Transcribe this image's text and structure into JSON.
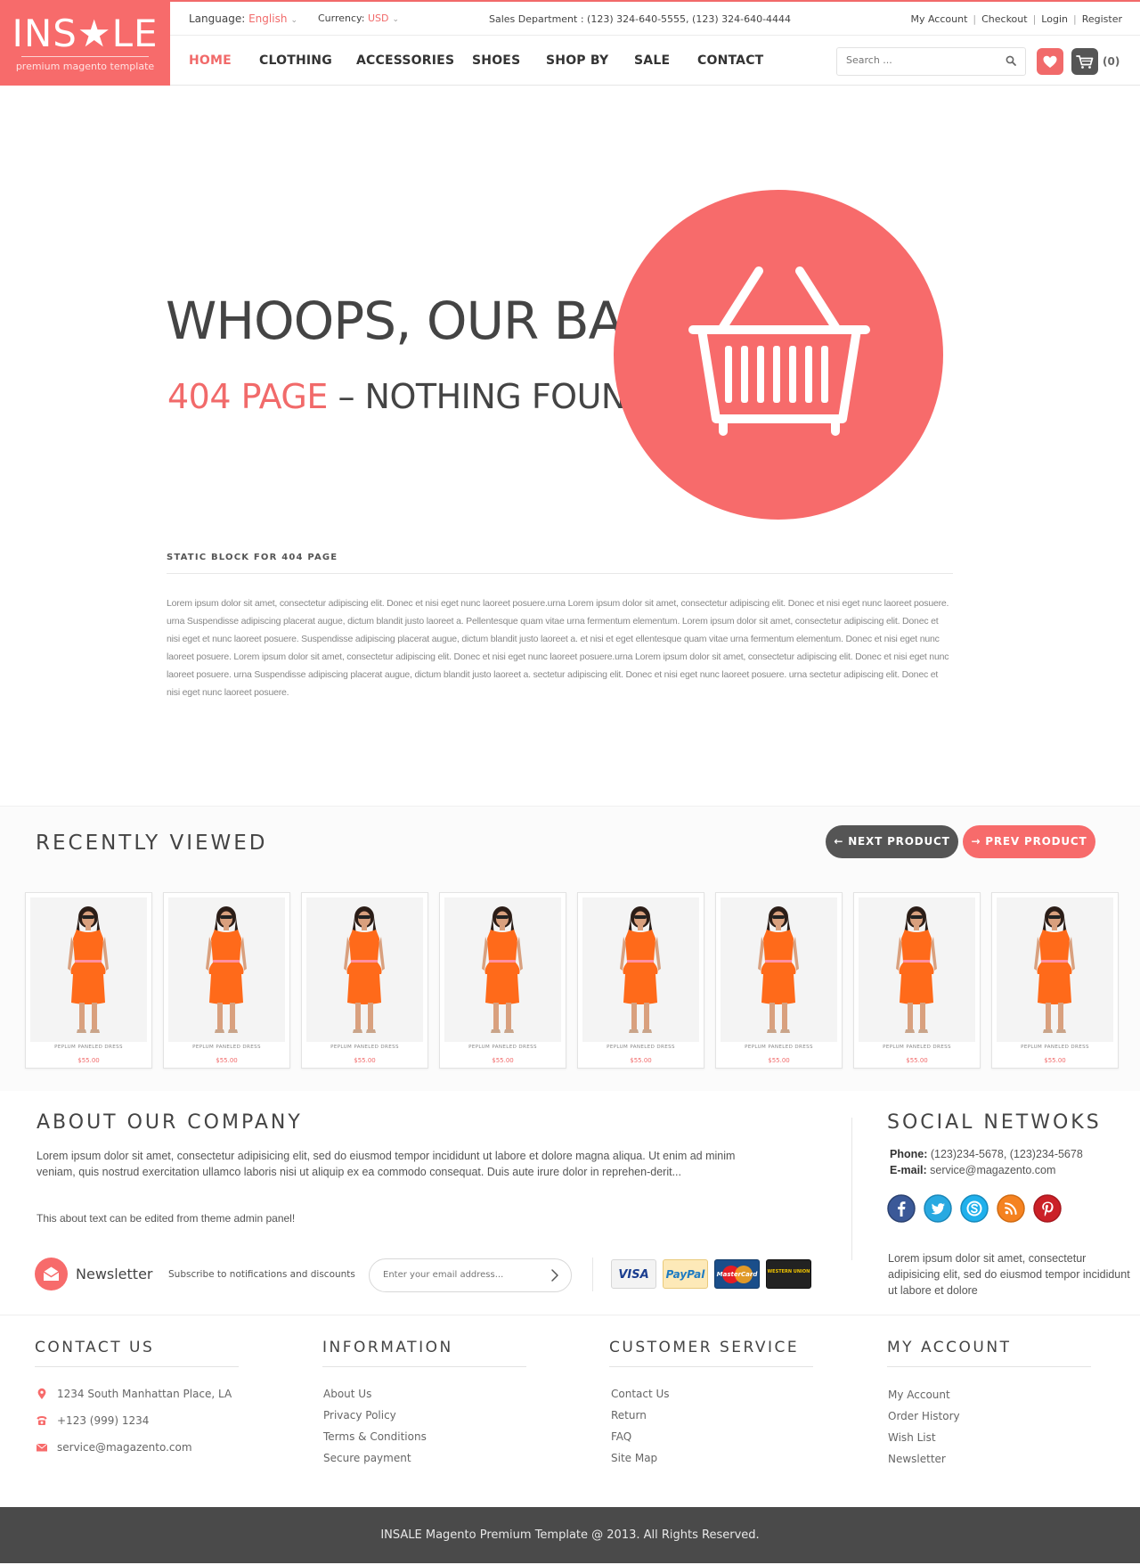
{
  "logo": {
    "word": "INS★LE",
    "tagline": "premium magento template",
    "color": "#f76b6b"
  },
  "topbar": {
    "language_label": "Language:",
    "language_value": "English",
    "currency_label": "Currency:",
    "currency_value": "USD",
    "sales": "Sales Department : (123) 324-640-5555, (123) 324-640-4444",
    "links": [
      "My Account",
      "Checkout",
      "Login",
      "Register"
    ]
  },
  "nav": {
    "items": [
      "HOME",
      "CLOTHING",
      "ACCESSORIES",
      "SHOES",
      "SHOP BY",
      "SALE",
      "CONTACT"
    ],
    "active": "HOME"
  },
  "search": {
    "placeholder": "Search ..."
  },
  "cart": {
    "count": "(0)"
  },
  "hero": {
    "title": "WHOOPS, OUR BAD",
    "sub_red": "404 PAGE",
    "sub_rest": " – NOTHING FOUND"
  },
  "static_block": {
    "title": "STATIC BLOCK FOR 404 PAGE",
    "text": "Lorem ipsum dolor sit amet, consectetur adipiscing elit. Donec et nisi eget nunc laoreet posuere.urna  Lorem ipsum dolor sit amet, consectetur adipiscing elit. Donec et nisi eget nunc laoreet posuere. urna Suspendisse adipiscing placerat augue, dictum blandit justo laoreet a. Pellentesque quam vitae urna fermentum elementum. Lorem ipsum dolor sit amet, consectetur adipiscing elit. Donec et nisi eget et nunc laoreet posuere. Suspendisse adipiscing placerat augue, dictum blandit justo laoreet a. et nisi et eget ellentesque quam vitae urna fermentum elementum.  Donec et nisi eget nunc laoreet posuere. Lorem ipsum dolor sit amet, consectetur adipiscing elit. Donec et nisi eget nunc laoreet posuere.urna  Lorem ipsum dolor sit amet, consectetur adipiscing elit. Donec et nisi eget nunc laoreet posuere. urna Suspendisse adipiscing placerat augue, dictum blandit justo laoreet a. sectetur adipiscing elit. Donec et nisi eget nunc laoreet posuere. urna sectetur adipiscing elit. Donec et nisi eget nunc laoreet posuere."
  },
  "recently_viewed": {
    "title": "RECENTLY VIEWED",
    "next_label": "NEXT PRODUCT",
    "prev_label": "PREV PRODUCT",
    "products": [
      {
        "name": "PEPLUM PANELED DRESS",
        "price": "$55.00"
      },
      {
        "name": "PEPLUM PANELED DRESS",
        "price": "$55.00"
      },
      {
        "name": "PEPLUM PANELED DRESS",
        "price": "$55.00"
      },
      {
        "name": "PEPLUM PANELED DRESS",
        "price": "$55.00"
      },
      {
        "name": "PEPLUM PANELED DRESS",
        "price": "$55.00"
      },
      {
        "name": "PEPLUM PANELED DRESS",
        "price": "$55.00"
      },
      {
        "name": "PEPLUM PANELED DRESS",
        "price": "$55.00"
      },
      {
        "name": "PEPLUM PANELED DRESS",
        "price": "$55.00"
      }
    ]
  },
  "about": {
    "title": "ABOUT OUR COMPANY",
    "text": "Lorem ipsum dolor sit amet, consectetur adipisicing elit, sed do eiusmod tempor incididunt ut labore et dolore magna aliqua. Ut enim ad minim veniam, quis nostrud exercitation ullamco laboris nisi ut aliquip ex ea commodo consequat. Duis aute irure dolor in reprehen-derit...",
    "note": "This about text can be edited from theme admin panel!"
  },
  "social": {
    "title": "SOCIAL NETWOKS",
    "phone_label": "Phone:",
    "phone": " (123)234-5678, (123)234-5678",
    "email_label": "E-mail:",
    "email": " service@magazento.com",
    "networks": [
      "facebook",
      "twitter",
      "skype",
      "rss",
      "pinterest"
    ],
    "text": "Lorem ipsum dolor sit amet, consectetur adipisicing elit, sed do eiusmod tempor incididunt ut labore et dolore"
  },
  "newsletter": {
    "title": "Newsletter",
    "subtitle": "Subscribe to notifications and discounts",
    "placeholder": "Enter your email address..."
  },
  "payments": [
    "VISA",
    "PayPal",
    "MasterCard",
    "WESTERN UNION"
  ],
  "footer": {
    "contact": {
      "title": "CONTACT US",
      "address": "1234 South Manhattan Place, LA",
      "phone": "+123 (999) 1234",
      "email": "service@magazento.com"
    },
    "information": {
      "title": "INFORMATION",
      "links": [
        "About Us",
        "Privacy Policy",
        "Terms & Conditions",
        "Secure payment"
      ]
    },
    "customer_service": {
      "title": "CUSTOMER SERVICE",
      "links": [
        "Contact Us",
        "Return",
        "FAQ",
        "Site Map"
      ]
    },
    "my_account": {
      "title": "MY ACCOUNT",
      "links": [
        "My Account",
        "Order History",
        "Wish List",
        "Newsletter"
      ]
    }
  },
  "copyright": "INSALE Magento Premium Template @ 2013. All Rights Reserved.",
  "colors": {
    "accent": "#f76b6b",
    "dark": "#555555",
    "footer_bar": "#4a4a4a"
  }
}
